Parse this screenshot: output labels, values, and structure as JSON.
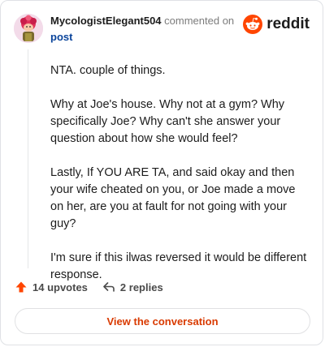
{
  "header": {
    "username": "MycologistElegant504",
    "commented_text": "commented on",
    "post_link": "post"
  },
  "brand": {
    "wordmark": "reddit",
    "accent_color": "#ff4500"
  },
  "comment": {
    "paragraphs": [
      "NTA. couple of things.",
      "Why at Joe's house. Why not at a gym? Why specifically Joe? Why can't she answer your question about how she would feel?",
      "Lastly, If YOU ARE TA, and said okay and then your wife cheated on you, or Joe made a move on her, are you at fault for not going with your guy?",
      "I'm sure if this ilwas reversed it would be different response."
    ]
  },
  "actions": {
    "upvotes": "14 upvotes",
    "replies": "2 replies",
    "upvote_icon": "upvote-arrow-icon",
    "reply_icon": "reply-arrow-icon"
  },
  "footer": {
    "view_button": "View the conversation",
    "button_color": "#d93a00"
  }
}
